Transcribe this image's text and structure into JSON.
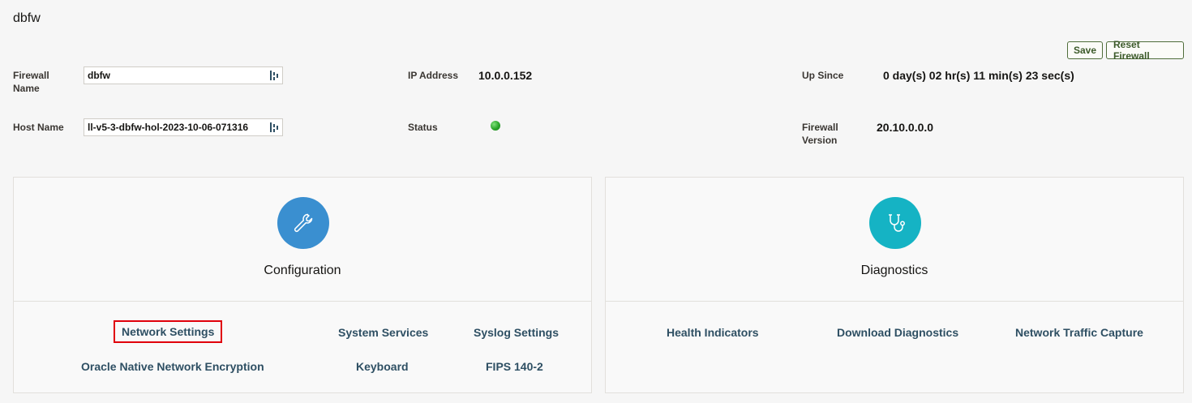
{
  "page": {
    "title": "dbfw"
  },
  "toolbar": {
    "save_label": "Save",
    "reset_label": "Reset Firewall"
  },
  "fields": {
    "firewall_name_label": "Firewall Name",
    "firewall_name_value": "dbfw",
    "host_name_label": "Host Name",
    "host_name_value": "ll-v5-3-dbfw-hol-2023-10-06-071316",
    "ip_label": "IP Address",
    "ip_value": "10.0.0.152",
    "status_label": "Status",
    "status_color": "#2aa52a",
    "up_since_label": "Up Since",
    "up_since_value": "0 day(s) 02 hr(s) 11 min(s) 23 sec(s)",
    "version_label": "Firewall Version",
    "version_value": "20.10.0.0.0"
  },
  "configuration": {
    "title": "Configuration",
    "icon": "wrench-icon",
    "color": "#3a8fd0",
    "links": {
      "network_settings": "Network Settings",
      "system_services": "System Services",
      "syslog_settings": "Syslog Settings",
      "oracle_nne": "Oracle Native Network Encryption",
      "keyboard": "Keyboard",
      "fips": "FIPS 140-2"
    }
  },
  "diagnostics": {
    "title": "Diagnostics",
    "icon": "stethoscope-icon",
    "color": "#15b3c4",
    "links": {
      "health_indicators": "Health Indicators",
      "download_diagnostics": "Download Diagnostics",
      "network_traffic_capture": "Network Traffic Capture"
    }
  }
}
